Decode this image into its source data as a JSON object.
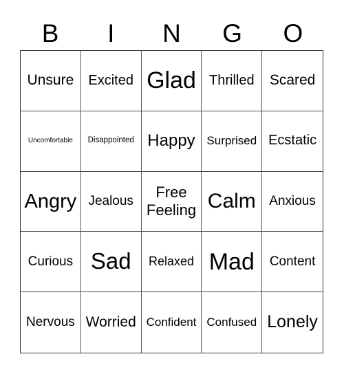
{
  "header": {
    "letters": [
      "B",
      "I",
      "N",
      "G",
      "O"
    ]
  },
  "cells": [
    [
      "Unsure",
      "Excited",
      "Glad",
      "Thrilled",
      "Scared"
    ],
    [
      "Uncomfortable",
      "Disappointed",
      "Happy",
      "Surprised",
      "Ecstatic"
    ],
    [
      "Angry",
      "Jealous",
      "Free Feeling",
      "Calm",
      "Anxious"
    ],
    [
      "Curious",
      "Sad",
      "Relaxed",
      "Mad",
      "Content"
    ],
    [
      "Nervous",
      "Worried",
      "Confident",
      "Confused",
      "Lonely"
    ]
  ]
}
